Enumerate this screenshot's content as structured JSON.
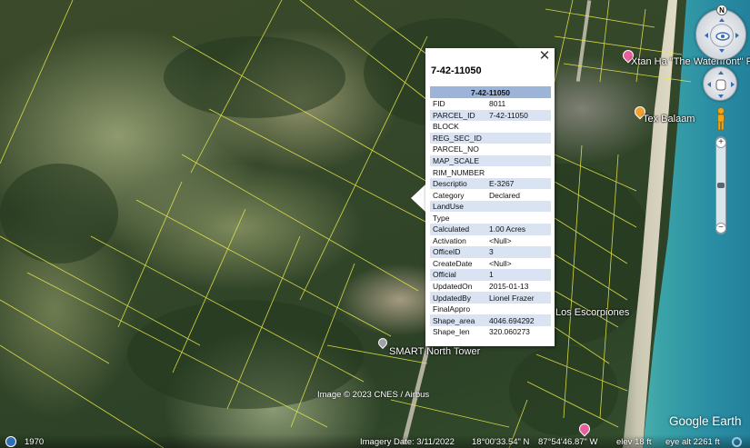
{
  "balloon": {
    "title": "7-42-11050",
    "table_header": "7-42-11050",
    "rows": [
      {
        "key": "FID",
        "value": "8011"
      },
      {
        "key": "PARCEL_ID",
        "value": "7-42-11050"
      },
      {
        "key": "BLOCK",
        "value": ""
      },
      {
        "key": "REG_SEC_ID",
        "value": ""
      },
      {
        "key": "PARCEL_NO",
        "value": ""
      },
      {
        "key": "MAP_SCALE",
        "value": ""
      },
      {
        "key": "RIM_NUMBER",
        "value": ""
      },
      {
        "key": "Descriptio",
        "value": "E-3267"
      },
      {
        "key": "Category",
        "value": "Declared"
      },
      {
        "key": "LandUse",
        "value": ""
      },
      {
        "key": "Type",
        "value": ""
      },
      {
        "key": "Calculated",
        "value": "1.00 Acres"
      },
      {
        "key": "Activation",
        "value": "<Null>"
      },
      {
        "key": "OfficeID",
        "value": "3"
      },
      {
        "key": "CreateDate",
        "value": "<Null>"
      },
      {
        "key": "Official",
        "value": "1"
      },
      {
        "key": "UpdatedOn",
        "value": "2015-01-13"
      },
      {
        "key": "UpdatedBy",
        "value": "Lionel Frazer"
      },
      {
        "key": "FinalAppro",
        "value": ""
      },
      {
        "key": "Shape_area",
        "value": "4046.694292"
      },
      {
        "key": "Shape_len",
        "value": "320.060273"
      }
    ],
    "close_glyph": "✕"
  },
  "places": {
    "xtan_ha": "Xtan Ha \"The Waterfront\" Resort",
    "tex_balaam": "Tex Balaam",
    "los_escorpiones": "Los Escorpiones",
    "smart_tower": "SMART North Tower"
  },
  "navigation": {
    "compass_north": "N",
    "zoom_in": "+",
    "zoom_out": "−"
  },
  "attribution": "Image © 2023 CNES / Airbus",
  "brand": "Google Earth",
  "status": {
    "history_year": "1970",
    "imagery_date": "Imagery Date: 3/11/2022",
    "latitude": "18°00'33.54\" N",
    "longitude": "87°54'46.87\" W",
    "elevation": "elev  18 ft",
    "eye_alt": "eye alt  2261 ft"
  },
  "colors": {
    "parcel_lines": "#e8e84a",
    "table_header": "#9cb4d8",
    "table_alt_row": "#d9e3f2",
    "pin_pink": "#e85d9b",
    "pin_orange": "#f0a030"
  }
}
